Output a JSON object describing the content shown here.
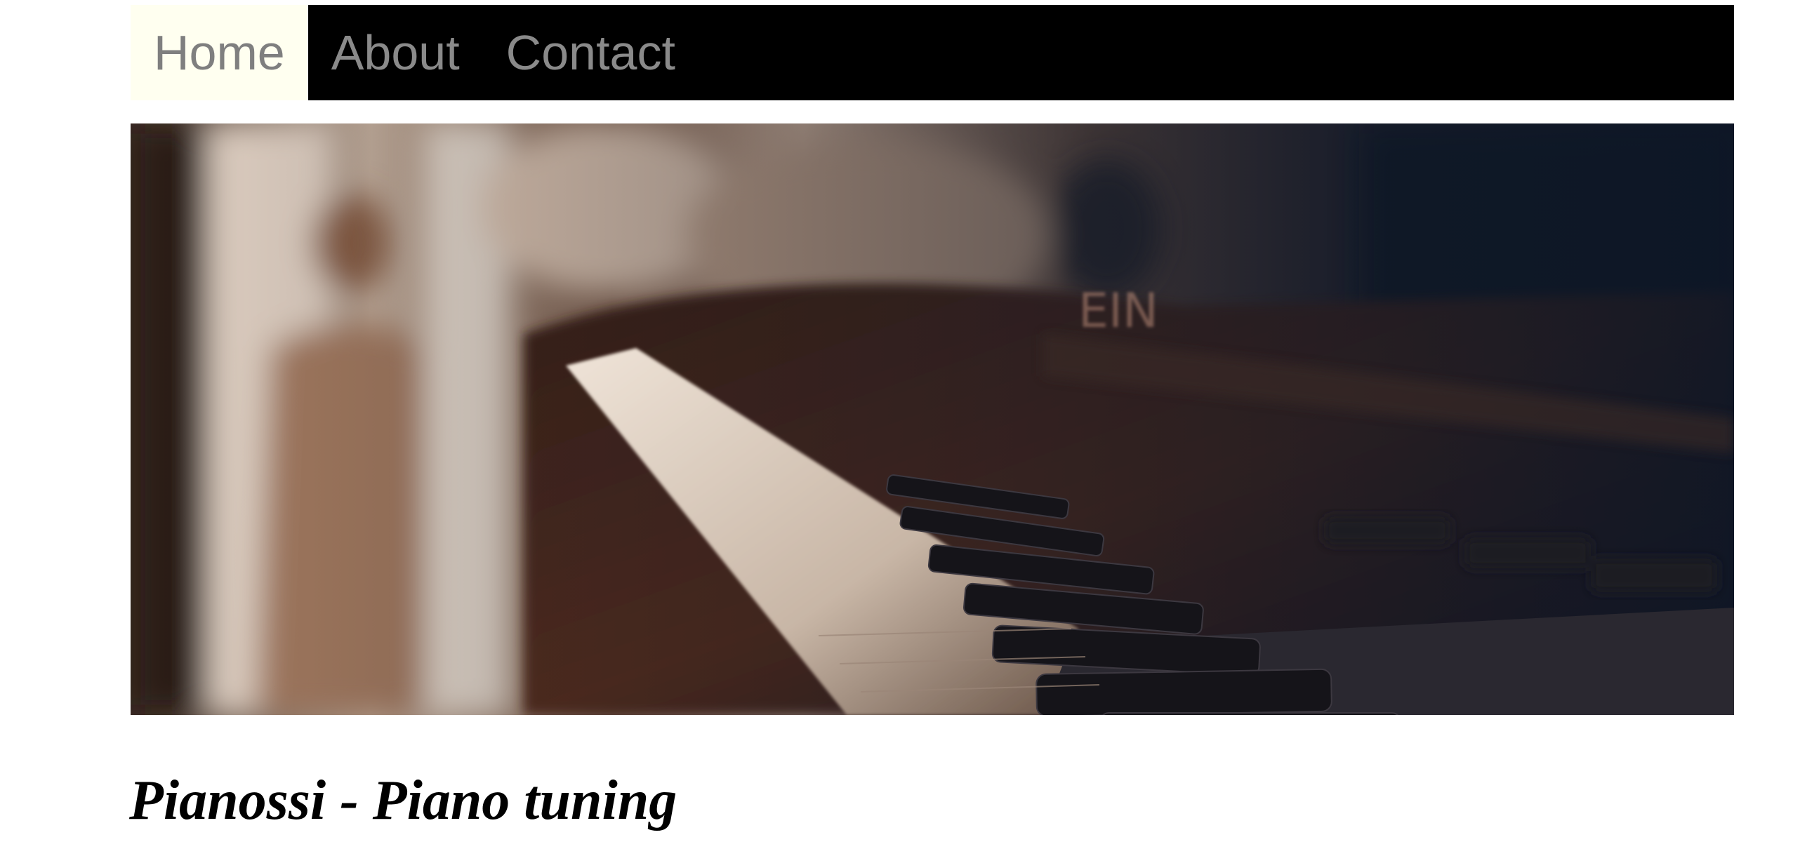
{
  "nav": {
    "items": [
      {
        "label": "Home",
        "active": true
      },
      {
        "label": "About",
        "active": false
      },
      {
        "label": "Contact",
        "active": false
      }
    ],
    "colors": {
      "bar": "#000000",
      "active_bg": "#fffff0",
      "text": "#8a8a8a"
    }
  },
  "hero": {
    "image_icon": "piano-keys-photo",
    "brand_mark": "EIN"
  },
  "main": {
    "title": "Pianossi - Piano tuning"
  }
}
